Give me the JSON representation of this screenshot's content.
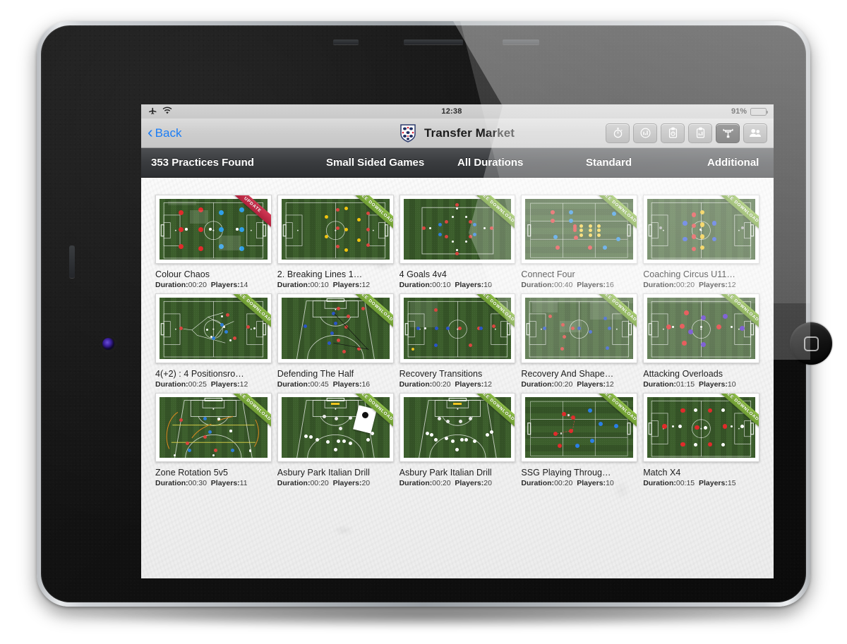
{
  "device": {
    "name": "tablet-black"
  },
  "status_bar": {
    "airplane_icon": "airplane-icon",
    "wifi_icon": "wifi-icon",
    "time": "12:38",
    "battery_percent": "91%",
    "battery_level": 91
  },
  "nav_bar": {
    "back_label": "Back",
    "back_chevron": "‹",
    "crest_icon": "england-fa-crest-icon",
    "title": "Transfer Market",
    "tools": [
      {
        "name": "stopwatch-icon",
        "active": false
      },
      {
        "name": "analytics-circle-icon",
        "active": false
      },
      {
        "name": "clipboard-stopwatch-icon",
        "active": false
      },
      {
        "name": "clipboard-analytics-icon",
        "active": false
      },
      {
        "name": "tournament-bracket-icon",
        "active": true
      },
      {
        "name": "people-icon",
        "active": false
      }
    ]
  },
  "filter_bar": {
    "results_count": "353 Practices Found",
    "filters": [
      {
        "label": "Small Sided Games"
      },
      {
        "label": "All Durations"
      },
      {
        "label": "Standard"
      },
      {
        "label": "Additional"
      }
    ]
  },
  "labels": {
    "duration_prefix": "Duration:",
    "players_prefix": "Players:"
  },
  "practices": [
    {
      "title": "Colour Chaos",
      "duration": "00:20",
      "players": "14",
      "badge": "UPDATE",
      "badge_type": "update",
      "badge_color": "#c62a48",
      "layout": "colour-chaos"
    },
    {
      "title": "2. Breaking Lines 1…",
      "duration": "00:10",
      "players": "12",
      "badge": "FREE DOWNLOAD",
      "badge_type": "free",
      "badge_color": "#7ead3e",
      "layout": "breaking-lines"
    },
    {
      "title": "4 Goals 4v4",
      "duration": "00:10",
      "players": "10",
      "badge": "FREE DOWNLOAD",
      "badge_type": "free",
      "badge_color": "#7ead3e",
      "layout": "four-goals"
    },
    {
      "title": "Connect Four",
      "duration": "00:40",
      "players": "16",
      "badge": "FREE DOWNLOAD",
      "badge_type": "free",
      "badge_color": "#7ead3e",
      "layout": "connect-four"
    },
    {
      "title": "Coaching Circus U11…",
      "duration": "00:20",
      "players": "12",
      "badge": "FREE DOWNLOAD",
      "badge_type": "free",
      "badge_color": "#7ead3e",
      "layout": "coaching-circus"
    },
    {
      "title": "4(+2) : 4 Positionsro…",
      "duration": "00:25",
      "players": "12",
      "badge": "FREE DOWNLOAD",
      "badge_type": "free",
      "badge_color": "#7ead3e",
      "layout": "positions-rot"
    },
    {
      "title": "Defending The Half",
      "duration": "00:45",
      "players": "16",
      "badge": "FREE DOWNLOAD",
      "badge_type": "free",
      "badge_color": "#7ead3e",
      "layout": "defending-half"
    },
    {
      "title": "Recovery Transitions",
      "duration": "00:20",
      "players": "12",
      "badge": "FREE DOWNLOAD",
      "badge_type": "free",
      "badge_color": "#7ead3e",
      "layout": "recovery-trans"
    },
    {
      "title": "Recovery And Shape…",
      "duration": "00:20",
      "players": "12",
      "badge": "FREE DOWNLOAD",
      "badge_type": "free",
      "badge_color": "#7ead3e",
      "layout": "recovery-shape"
    },
    {
      "title": "Attacking Overloads",
      "duration": "01:15",
      "players": "10",
      "badge": "FREE DOWNLOAD",
      "badge_type": "free",
      "badge_color": "#7ead3e",
      "layout": "attacking-overloads"
    },
    {
      "title": "Zone Rotation 5v5",
      "duration": "00:30",
      "players": "11",
      "badge": "FREE DOWNLOAD",
      "badge_type": "free",
      "badge_color": "#7ead3e",
      "layout": "zone-rotation"
    },
    {
      "title": "Asbury Park Italian Drill",
      "duration": "00:20",
      "players": "20",
      "badge": "FREE DOWNLOAD",
      "badge_type": "free",
      "badge_color": "#7ead3e",
      "layout": "asbury-1"
    },
    {
      "title": "Asbury Park Italian Drill",
      "duration": "00:20",
      "players": "20",
      "badge": "FREE DOWNLOAD",
      "badge_type": "free",
      "badge_color": "#7ead3e",
      "layout": "asbury-2"
    },
    {
      "title": "SSG Playing Throug…",
      "duration": "00:20",
      "players": "10",
      "badge": "FREE DOWNLOAD",
      "badge_type": "free",
      "badge_color": "#7ead3e",
      "layout": "ssg-playing"
    },
    {
      "title": "Match X4",
      "duration": "00:15",
      "players": "15",
      "badge": "FREE DOWNLOAD",
      "badge_type": "free",
      "badge_color": "#7ead3e",
      "layout": "match-x4"
    }
  ],
  "colors": {
    "accent_link": "#1b7df5",
    "pitch_green_light": "#3c5e2c",
    "pitch_green_dark": "#345226",
    "ribbon_free": "#7ead3e",
    "ribbon_update": "#c62a48",
    "filter_bar_bg": "#3a3c3f",
    "nav_bar_bg": "#cdcdcd"
  }
}
